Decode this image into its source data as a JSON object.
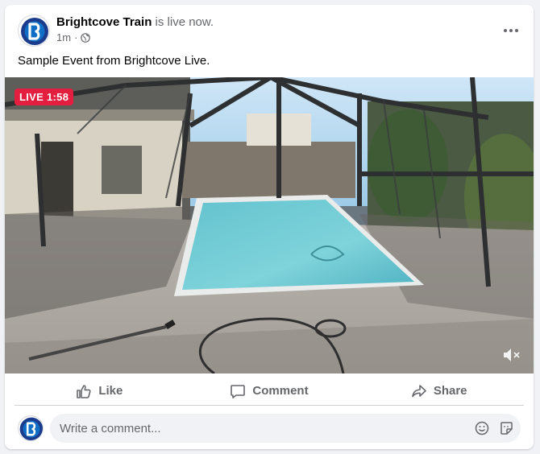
{
  "post": {
    "page_name": "Brightcove Train",
    "status_text": "is live now.",
    "time": "1m",
    "separator": "·",
    "privacy_icon": "globe-icon",
    "text": "Sample Event from Brightcove Live."
  },
  "video": {
    "live_label": "LIVE 1:58",
    "muted": true
  },
  "actions": {
    "like": "Like",
    "comment": "Comment",
    "share": "Share"
  },
  "comment": {
    "placeholder": "Write a comment..."
  },
  "colors": {
    "brand": "#1b3c8c",
    "live": "#e41e3f",
    "secondary_text": "#65676b"
  }
}
